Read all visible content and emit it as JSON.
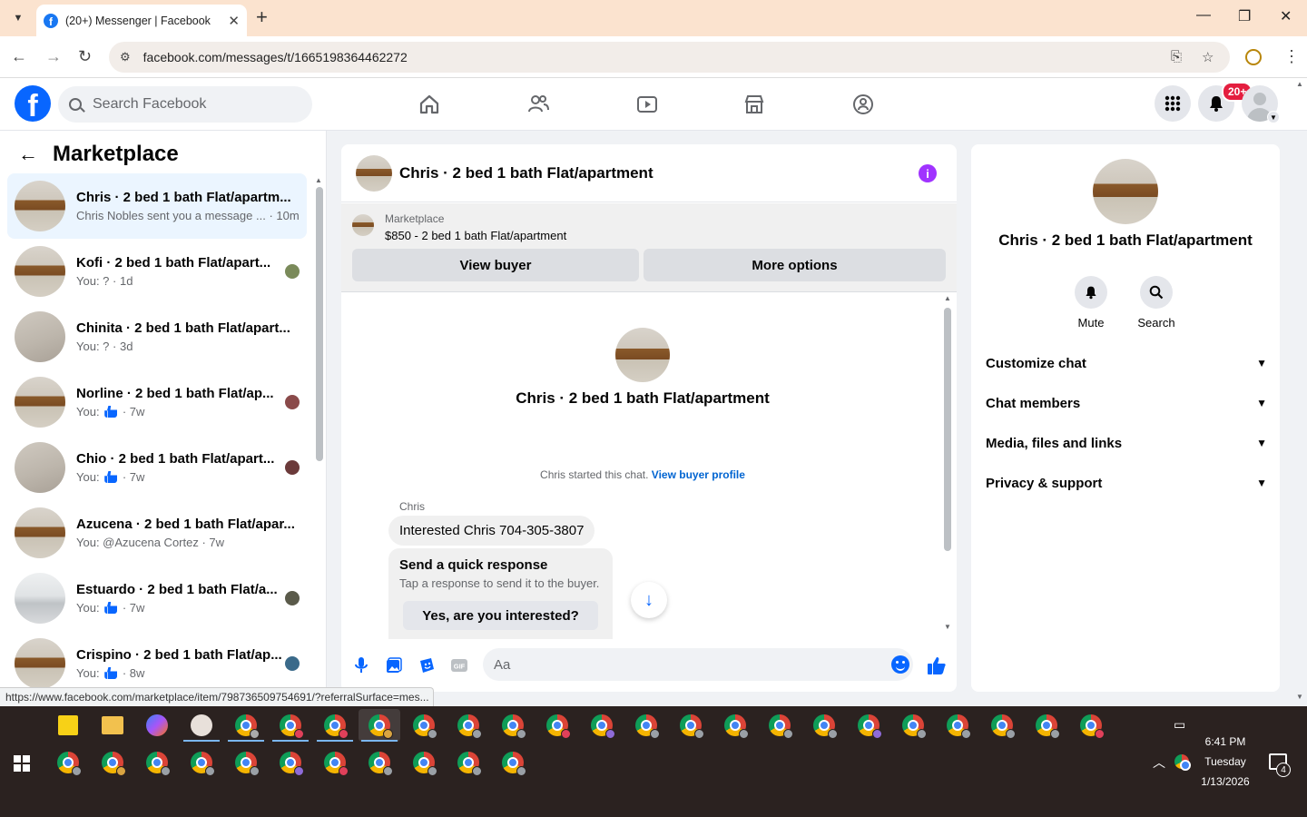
{
  "browser": {
    "tab_title": "(20+) Messenger | Facebook",
    "url": "facebook.com/messages/t/1665198364462272",
    "status_url": "https://www.facebook.com/marketplace/item/798736509754691/?referralSurface=mes..."
  },
  "fb_header": {
    "search_placeholder": "Search Facebook",
    "notification_badge": "20+",
    "nav_icons": [
      "home-icon",
      "friends-icon",
      "video-icon",
      "marketplace-icon",
      "groups-icon"
    ],
    "accent": "#0866ff"
  },
  "left_panel": {
    "title": "Marketplace",
    "conversations": [
      {
        "name": "Chris · 2 bed 1 bath Flat/apartm...",
        "sub": "Chris Nobles sent you a message ...",
        "time": "· 10m",
        "active": true
      },
      {
        "name": "Kofi · 2 bed 1 bath Flat/apart...",
        "sub": "You: ?",
        "time": "· 1d"
      },
      {
        "name": "Chinita · 2 bed 1 bath Flat/apart...",
        "sub": "You: ?",
        "time": "· 3d"
      },
      {
        "name": "Norline · 2 bed 1 bath Flat/ap...",
        "sub": "You:",
        "time": "· 7w"
      },
      {
        "name": "Chio · 2 bed 1 bath Flat/apart...",
        "sub": "You:",
        "time": "· 7w"
      },
      {
        "name": "Azucena · 2 bed 1 bath Flat/apar...",
        "sub": "You: @Azucena Cortez",
        "time": "· 7w"
      },
      {
        "name": "Estuardo · 2 bed 1 bath Flat/a...",
        "sub": "You:",
        "time": "· 7w"
      },
      {
        "name": "Crispino · 2 bed 1 bath Flat/ap...",
        "sub": "You:",
        "time": "· 8w"
      }
    ]
  },
  "chat": {
    "title": "Chris · 2 bed 1 bath Flat/apartment",
    "marketplace_label": "Marketplace",
    "listing": "$850 - 2 bed 1 bath Flat/apartment",
    "view_buyer": "View buyer",
    "more_options": "More options",
    "center_name": "Chris · 2 bed 1 bath Flat/apartment",
    "started_text": "Chris started this chat.",
    "view_buyer_profile": "View buyer profile",
    "sender": "Chris",
    "message": "Interested Chris 704-305-3807",
    "quick_title": "Send a quick response",
    "quick_sub": "Tap a response to send it to the buyer.",
    "quick_option": "Yes, are you interested?",
    "composer_placeholder": "Aa"
  },
  "right_panel": {
    "name": "Chris · 2 bed 1 bath Flat/apartment",
    "mute": "Mute",
    "search": "Search",
    "sections": [
      "Customize chat",
      "Chat members",
      "Media, files and links",
      "Privacy & support"
    ]
  },
  "taskbar": {
    "time": "6:41 PM",
    "day": "Tuesday",
    "date": "1/13/2026",
    "notif_count": "4"
  }
}
